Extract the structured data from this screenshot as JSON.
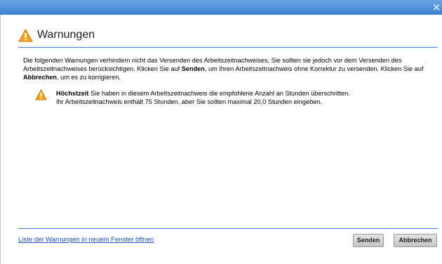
{
  "window": {
    "close_glyph": "×"
  },
  "header": {
    "title": "Warnungen",
    "icon": "warning-icon"
  },
  "intro": {
    "part1": "Die folgenden Warnungen verhindern nicht das Versenden des Arbeitszeitnachweises, Sie sollten sie jedoch vor dem Versenden des Arbeitszeitnachweises berücksichtigen. Klicken Sie auf ",
    "send_word": "Senden",
    "part2": ", um Ihren Arbeitszeitnachweis ohne Korrektur zu versenden. Klicken Sie auf ",
    "cancel_word": "Abbrechen",
    "part3": ", um es zu korrigieren."
  },
  "warnings": [
    {
      "title": "Höchstzeit",
      "line1": " Sie haben in diesem Arbeitszeitnachweis die empfohlene Anzahl an Stunden überschritten.",
      "line2": "Ihr Arbeitszeitnachweis enthält 75 Stunden, aber Sie sollten maximal 20,0 Stunden eingeben.",
      "icon": "warning-icon"
    }
  ],
  "footer": {
    "link_label": "Liste der Warnungen in neuem Fenster öffnen",
    "send_label": "Senden",
    "cancel_label": "Abbrechen"
  },
  "colors": {
    "titlebar": "#3f83d6",
    "rule": "#3f83d6",
    "link": "#1a4fb0",
    "warning": "#f5a000"
  }
}
